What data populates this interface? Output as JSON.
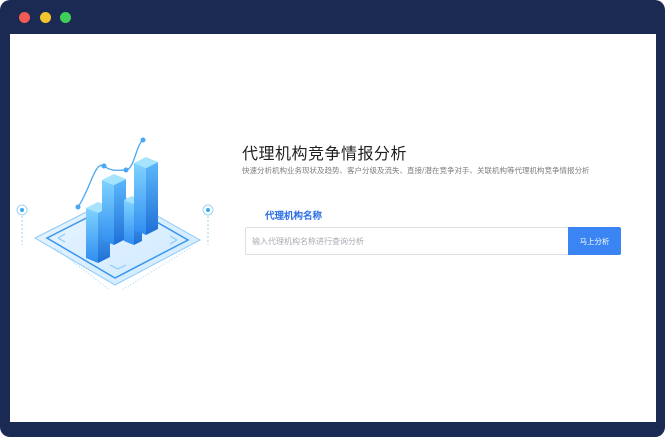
{
  "window": {
    "controls": [
      "close",
      "minimize",
      "maximize"
    ]
  },
  "main": {
    "title": "代理机构竞争情报分析",
    "subtitle": "快速分析机构业务现状及趋势、客户分级及流失、直接/潜在竞争对手、关联机构等代理机构竞争情报分析",
    "field_label": "代理机构名称",
    "search": {
      "placeholder": "输入代理机构名称进行查询分析",
      "value": ""
    },
    "analyze_button": "马上分析"
  },
  "colors": {
    "frame": "#1b2a52",
    "accent": "#3a84f3",
    "label": "#2b6ee6"
  }
}
